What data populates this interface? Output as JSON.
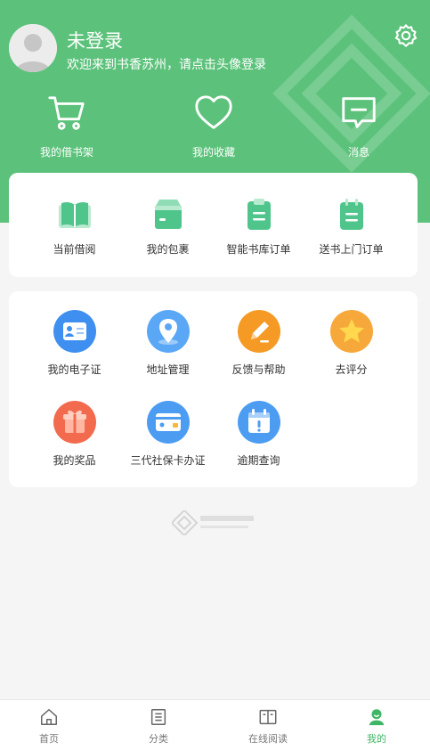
{
  "colors": {
    "brand": "#5cc27b",
    "active": "#3fb664"
  },
  "header": {
    "title": "未登录",
    "subtitle": "欢迎来到书香苏州，请点击头像登录",
    "icons": {
      "avatar": "user-avatar",
      "settings": "gear-icon"
    }
  },
  "top_actions": [
    {
      "label": "我的借书架",
      "icon": "shopping-cart-icon"
    },
    {
      "label": "我的收藏",
      "icon": "heart-icon"
    },
    {
      "label": "消息",
      "icon": "message-icon"
    }
  ],
  "quick_menu": [
    {
      "label": "当前借阅",
      "icon": "open-book-icon"
    },
    {
      "label": "我的包裹",
      "icon": "package-icon"
    },
    {
      "label": "智能书库订单",
      "icon": "clipboard-icon"
    },
    {
      "label": "送书上门订单",
      "icon": "notepad-icon"
    }
  ],
  "services": [
    {
      "label": "我的电子证",
      "icon": "id-card-icon"
    },
    {
      "label": "地址管理",
      "icon": "location-pin-icon"
    },
    {
      "label": "反馈与帮助",
      "icon": "pencil-icon"
    },
    {
      "label": "去评分",
      "icon": "star-icon"
    },
    {
      "label": "我的奖品",
      "icon": "gift-icon"
    },
    {
      "label": "三代社保卡办证",
      "icon": "card-icon"
    },
    {
      "label": "逾期查询",
      "icon": "calendar-alert-icon"
    }
  ],
  "tabs": [
    {
      "label": "首页",
      "icon": "home-icon"
    },
    {
      "label": "分类",
      "icon": "list-icon"
    },
    {
      "label": "在线阅读",
      "icon": "book-icon"
    },
    {
      "label": "我的",
      "icon": "user-icon",
      "active": true
    }
  ]
}
